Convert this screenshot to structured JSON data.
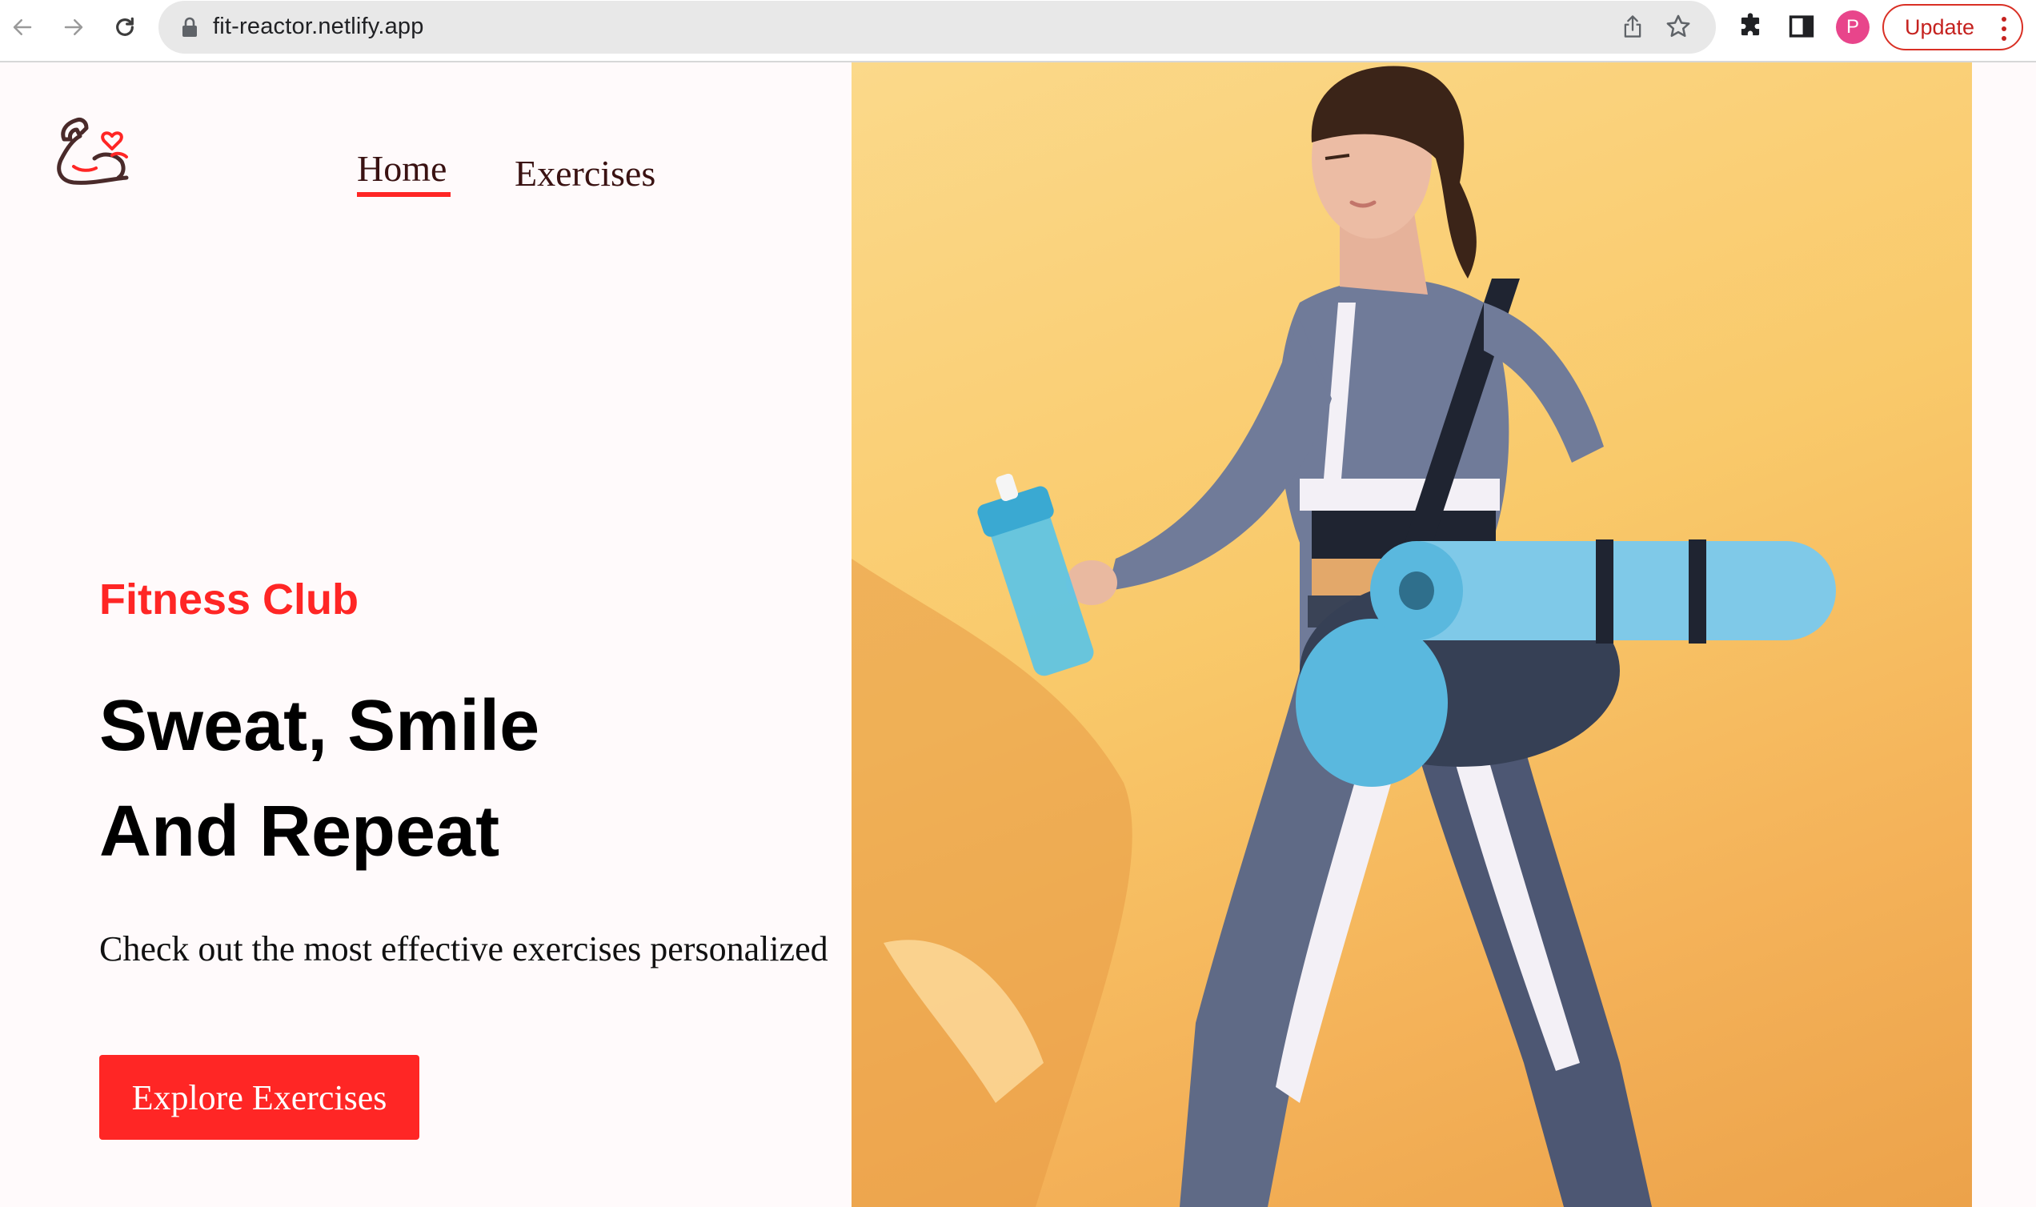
{
  "browser": {
    "url": "fit-reactor.netlify.app",
    "profile_initial": "P",
    "update_label": "Update"
  },
  "nav": {
    "home_label": "Home",
    "exercises_label": "Exercises"
  },
  "hero": {
    "tagline": "Fitness Club",
    "headline_line1": "Sweat, Smile",
    "headline_line2": "And Repeat",
    "description": "Check out the most effective exercises personalized",
    "cta_label": "Explore Exercises"
  },
  "colors": {
    "accent": "#ff2625",
    "page_background": "#fffafb",
    "hero_image_background": "#f9c96a",
    "nav_text": "#3a1212",
    "profile_avatar": "#e8458b"
  },
  "icons": {
    "logo": "flexed-arm-heart-icon",
    "back": "arrow-left-icon",
    "forward": "arrow-right-icon",
    "reload": "reload-icon",
    "lock": "lock-icon",
    "share": "share-icon",
    "bookmark": "star-icon",
    "extensions": "puzzle-icon",
    "side_panel": "side-panel-icon",
    "menu": "kebab-menu-icon"
  }
}
